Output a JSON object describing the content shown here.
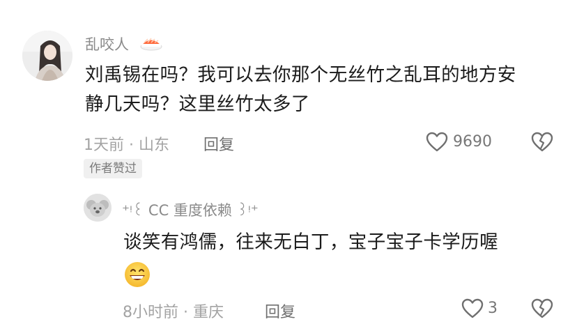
{
  "comment": {
    "username": "乱咬人",
    "text_line1": "刘禹锡在吗？我可以去你那个无丝竹之乱耳的地方安",
    "text_line2": "静几天吗？这里丝竹太多了",
    "time": "1天前",
    "location": "山东",
    "reply_label": "回复",
    "like_count": "9690",
    "badge": "作者赞过",
    "icons": {
      "avatar": "user-avatar",
      "name_emoji": "sushi-emoji",
      "like": "heart-outline-icon",
      "dislike": "broken-heart-icon"
    }
  },
  "reply": {
    "username": "⁺ᵎ꒰ CC 重度依赖 ꒱ᵎ⁺",
    "text_line1": "谈笑有鸿儒，往来无白丁，宝子宝子卡学历喔",
    "time": "8小时前",
    "location": "重庆",
    "reply_label": "回复",
    "like_count": "3",
    "icons": {
      "avatar": "koala-avatar",
      "emoji": "grinning-face-emoji",
      "like": "heart-outline-icon",
      "dislike": "broken-heart-icon"
    }
  },
  "colors": {
    "text": "#1b1b1b",
    "muted": "#a3a3a3",
    "icon": "#6f6f6f",
    "badge_bg": "#f0f0f0"
  }
}
